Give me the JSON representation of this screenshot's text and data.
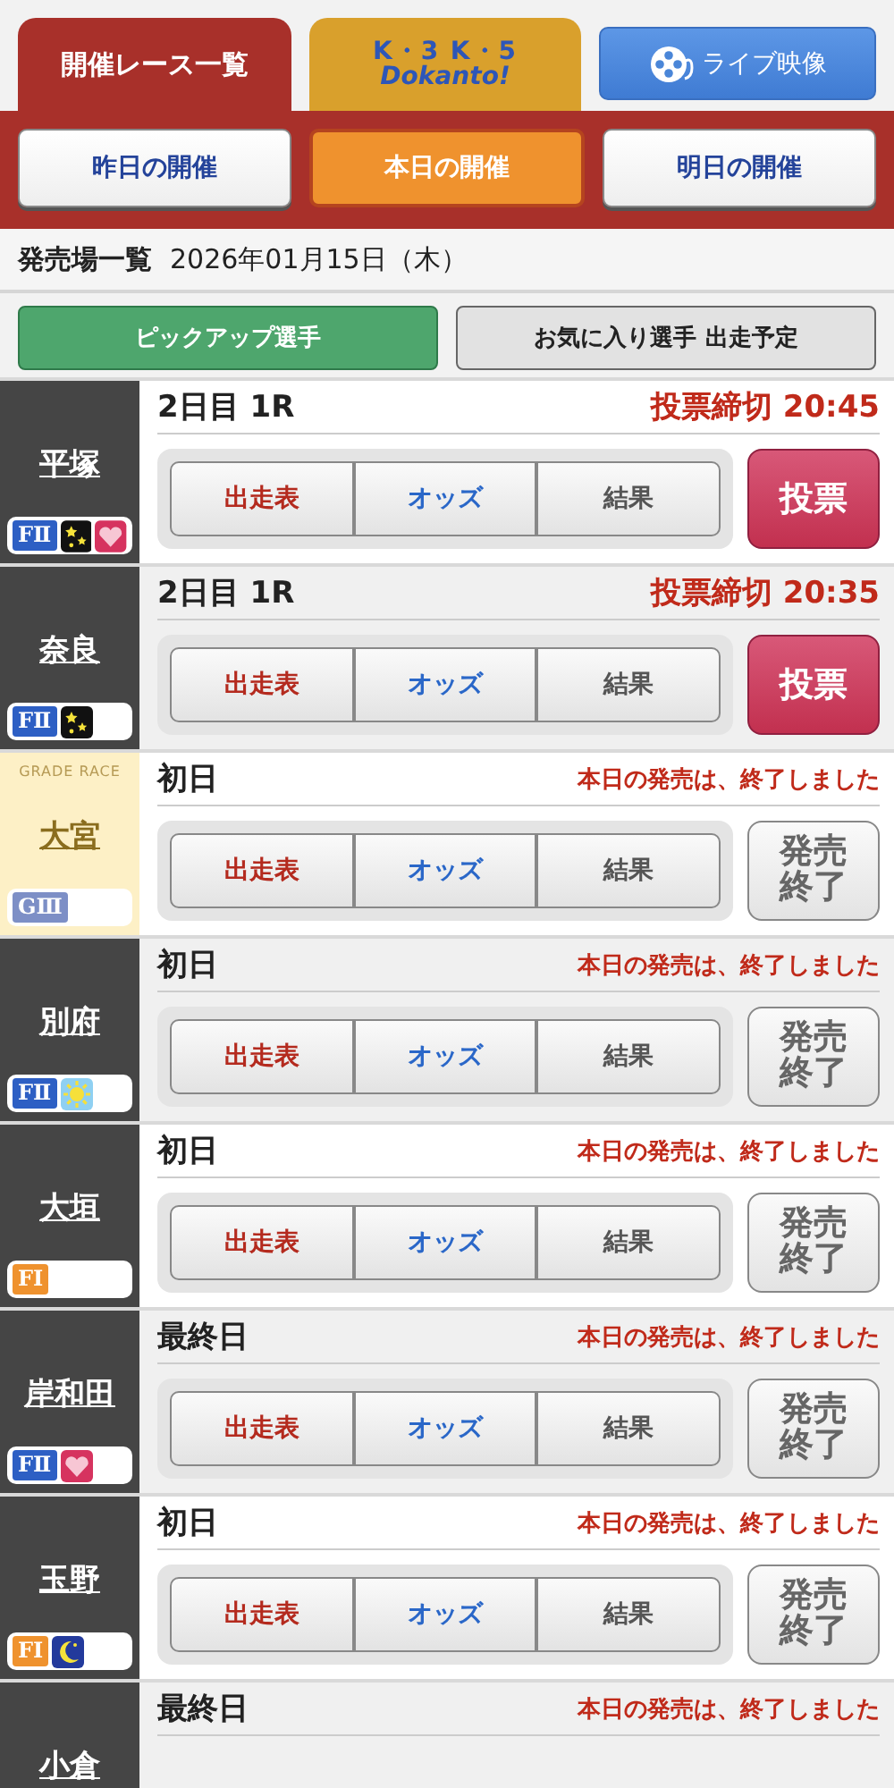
{
  "top_tabs": [
    {
      "kind": "text",
      "label": "開催レース一覧"
    },
    {
      "kind": "logo",
      "label": "K・3 K・5",
      "sublabel": "Dokanto!"
    },
    {
      "kind": "video",
      "label": "ライブ映像"
    }
  ],
  "day_tabs": [
    {
      "label": "昨日の開催",
      "selected": false
    },
    {
      "label": "本日の開催",
      "selected": true
    },
    {
      "label": "明日の開催",
      "selected": false
    }
  ],
  "date_line": {
    "title": "発売場一覧",
    "date": "2026年01月15日（木）"
  },
  "filter_buttons": [
    {
      "label": "ピックアップ選手",
      "selected": true
    },
    {
      "label": "お気に入り選手 出走予定",
      "selected": false
    }
  ],
  "venues": [
    {
      "name": "平塚",
      "grade": {
        "kind": "F2",
        "label": "FⅡ"
      },
      "tags": [
        {
          "kind": "night"
        },
        {
          "kind": "girls"
        }
      ],
      "grade_race": false,
      "day": "2日目 1R",
      "status": {
        "kind": "open",
        "text": "投票締切 20:45"
      },
      "links": [
        "出走表",
        "オッズ",
        "結果"
      ],
      "action": "投票"
    },
    {
      "name": "奈良",
      "grade": {
        "kind": "F2",
        "label": "FⅡ"
      },
      "tags": [
        {
          "kind": "night"
        }
      ],
      "grade_race": false,
      "day": "2日目 1R",
      "status": {
        "kind": "open",
        "text": "投票締切 20:35"
      },
      "links": [
        "出走表",
        "オッズ",
        "結果"
      ],
      "action": "投票"
    },
    {
      "name": "大宮",
      "grade": {
        "kind": "G3",
        "label": "GⅢ"
      },
      "grade_race": true,
      "grade_race_label": "GRADE RACE",
      "day": "初日",
      "status": {
        "kind": "closed",
        "text": "本日の発売は、終了しました"
      },
      "links": [
        "出走表",
        "オッズ",
        "結果"
      ],
      "action": "発売終了"
    },
    {
      "name": "別府",
      "grade": {
        "kind": "F2",
        "label": "FⅡ"
      },
      "tags": [
        {
          "kind": "morning"
        }
      ],
      "grade_race": false,
      "day": "初日",
      "status": {
        "kind": "closed",
        "text": "本日の発売は、終了しました"
      },
      "links": [
        "出走表",
        "オッズ",
        "結果"
      ],
      "action": "発売終了"
    },
    {
      "name": "大垣",
      "grade": {
        "kind": "F1",
        "label": "FⅠ"
      },
      "grade_race": false,
      "day": "初日",
      "status": {
        "kind": "closed",
        "text": "本日の発売は、終了しました"
      },
      "links": [
        "出走表",
        "オッズ",
        "結果"
      ],
      "action": "発売終了"
    },
    {
      "name": "岸和田",
      "grade": {
        "kind": "F2",
        "label": "FⅡ"
      },
      "tags": [
        {
          "kind": "girls"
        }
      ],
      "grade_race": false,
      "day": "最終日",
      "status": {
        "kind": "closed",
        "text": "本日の発売は、終了しました"
      },
      "links": [
        "出走表",
        "オッズ",
        "結果"
      ],
      "action": "発売終了"
    },
    {
      "name": "玉野",
      "grade": {
        "kind": "F1",
        "label": "FⅠ"
      },
      "tags": [
        {
          "kind": "midnight"
        }
      ],
      "grade_race": false,
      "day": "初日",
      "status": {
        "kind": "closed",
        "text": "本日の発売は、終了しました"
      },
      "links": [
        "出走表",
        "オッズ",
        "結果"
      ],
      "action": "発売終了"
    },
    {
      "name": "小倉",
      "grade_race": false,
      "day": "最終日",
      "status": {
        "kind": "closed",
        "text": "本日の発売は、終了しました"
      }
    }
  ]
}
